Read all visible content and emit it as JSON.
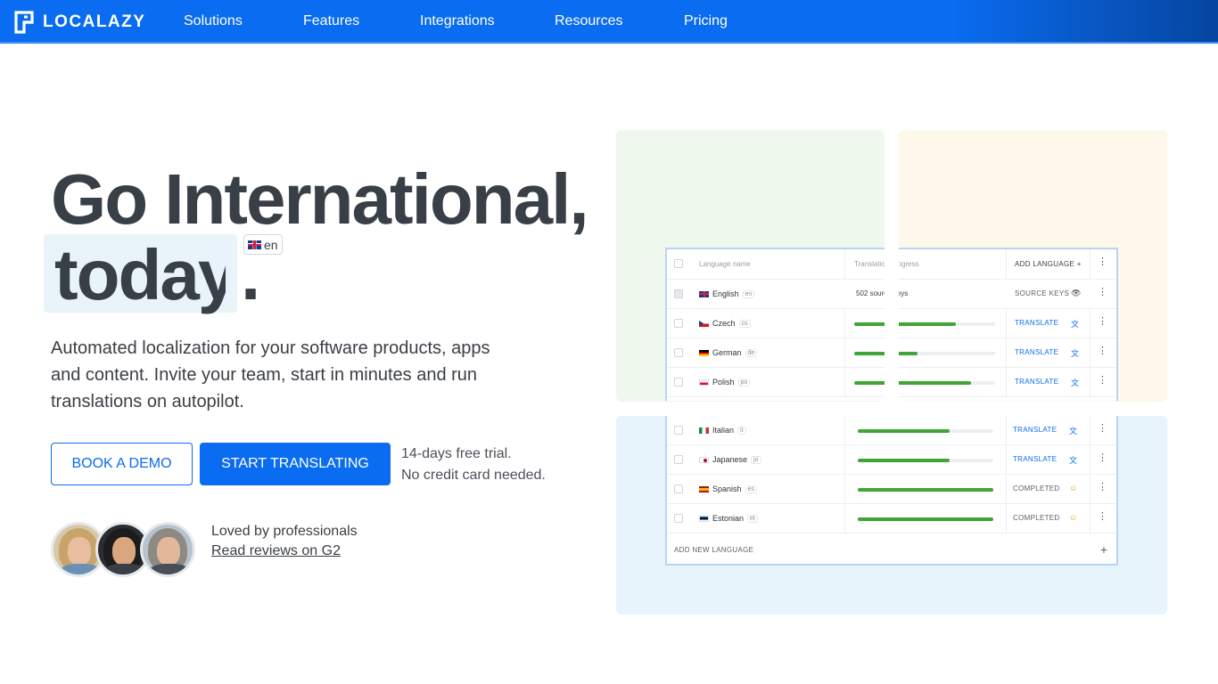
{
  "nav": {
    "brand": "LOCALAZY",
    "items": [
      "Solutions",
      "Features",
      "Integrations",
      "Resources",
      "Pricing"
    ]
  },
  "hero": {
    "title_line1": "Go International,",
    "title_word": "today",
    "title_period": ".",
    "lang_badge": "en",
    "subtitle": "Automated localization for your software products, apps and content. Invite your team, start in minutes and run translations on autopilot.",
    "btn_demo": "BOOK A DEMO",
    "btn_start": "START TRANSLATING",
    "trial_line1": "14-days free trial.",
    "trial_line2": "No credit card needed.",
    "loved": "Loved by professionals",
    "reviews": "Read reviews on G2"
  },
  "table": {
    "header": {
      "language_name": "Language name",
      "progress": "Translation progress",
      "add_language": "ADD LANGUAGE"
    },
    "source_row": {
      "name": "English",
      "code": "en",
      "info": "502 source keys",
      "action": "SOURCE KEYS"
    },
    "rows_top": [
      {
        "name": "Czech",
        "code": "cs",
        "progress": 0.72,
        "action": "TRANSLATE",
        "flag": "cz"
      },
      {
        "name": "German",
        "code": "de",
        "progress": 0.45,
        "action": "TRANSLATE",
        "flag": "de"
      },
      {
        "name": "Polish",
        "code": "po",
        "progress": 0.83,
        "action": "TRANSLATE",
        "flag": "pl"
      }
    ],
    "rows_bottom": [
      {
        "name": "Italian",
        "code": "it",
        "progress": 0.68,
        "action": "TRANSLATE",
        "flag": "it"
      },
      {
        "name": "Japanese",
        "code": "jo",
        "progress": 0.68,
        "action": "TRANSLATE",
        "flag": "jp"
      },
      {
        "name": "Spanish",
        "code": "es",
        "progress": 1.0,
        "action": "COMPLETED",
        "flag": "es"
      },
      {
        "name": "Estonian",
        "code": "et",
        "progress": 1.0,
        "action": "COMPLETED",
        "flag": "ee"
      }
    ],
    "add_new": "ADD NEW LANGUAGE"
  },
  "colors": {
    "primary": "#0a6cf0",
    "progress": "#3fa535",
    "heading": "#393f46"
  }
}
